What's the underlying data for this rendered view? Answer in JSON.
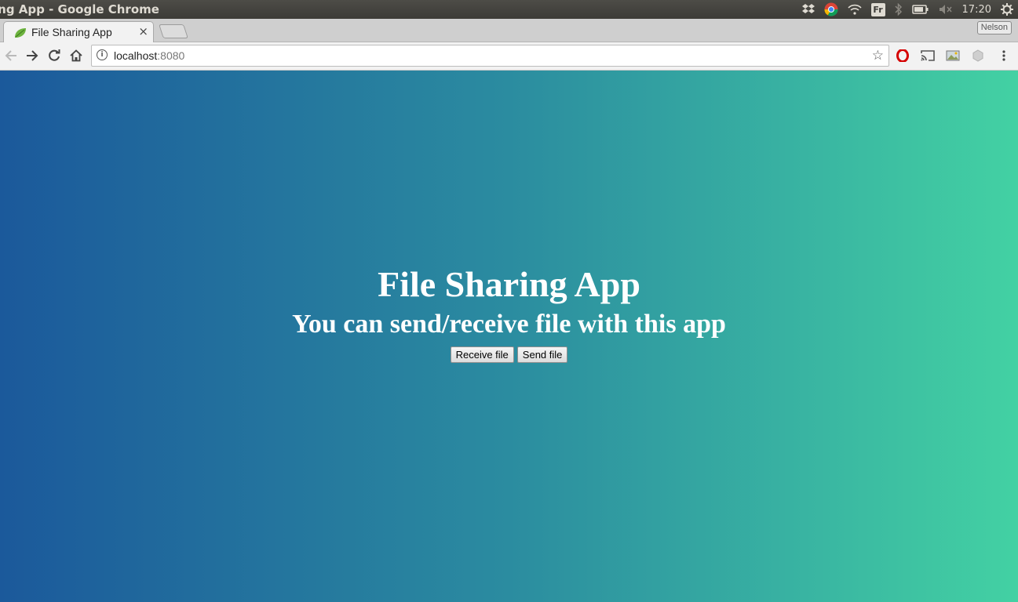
{
  "os_panel": {
    "window_title": "ing App - Google Chrome",
    "indicators": [
      "dropbox-icon",
      "chrome-icon",
      "wifi-icon",
      "keyboard-layout-indicator",
      "bluetooth-icon",
      "battery-icon",
      "volume-muted-icon",
      "settings-gear-icon"
    ],
    "keyboard_layout": "Fr",
    "clock": "17:20"
  },
  "browser": {
    "tab": {
      "title": "File Sharing App",
      "favicon": "spring-leaf-icon",
      "close_symbol": "×"
    },
    "profile_name": "Nelson",
    "address": {
      "host": "localhost",
      "port": ":8080"
    },
    "toolbar_icons": [
      "back-icon",
      "forward-icon",
      "reload-icon",
      "home-icon",
      "info-icon",
      "bookmark-star-icon",
      "opera-icon",
      "cast-icon",
      "image-extension-icon",
      "extension-icon",
      "menu-icon"
    ]
  },
  "page": {
    "title": "File Sharing App",
    "subtitle": "You can send/receive file with this app",
    "buttons": {
      "receive": "Receive file",
      "send": "Send file"
    },
    "gradient": [
      "#1b599b",
      "#43d1a3"
    ]
  }
}
